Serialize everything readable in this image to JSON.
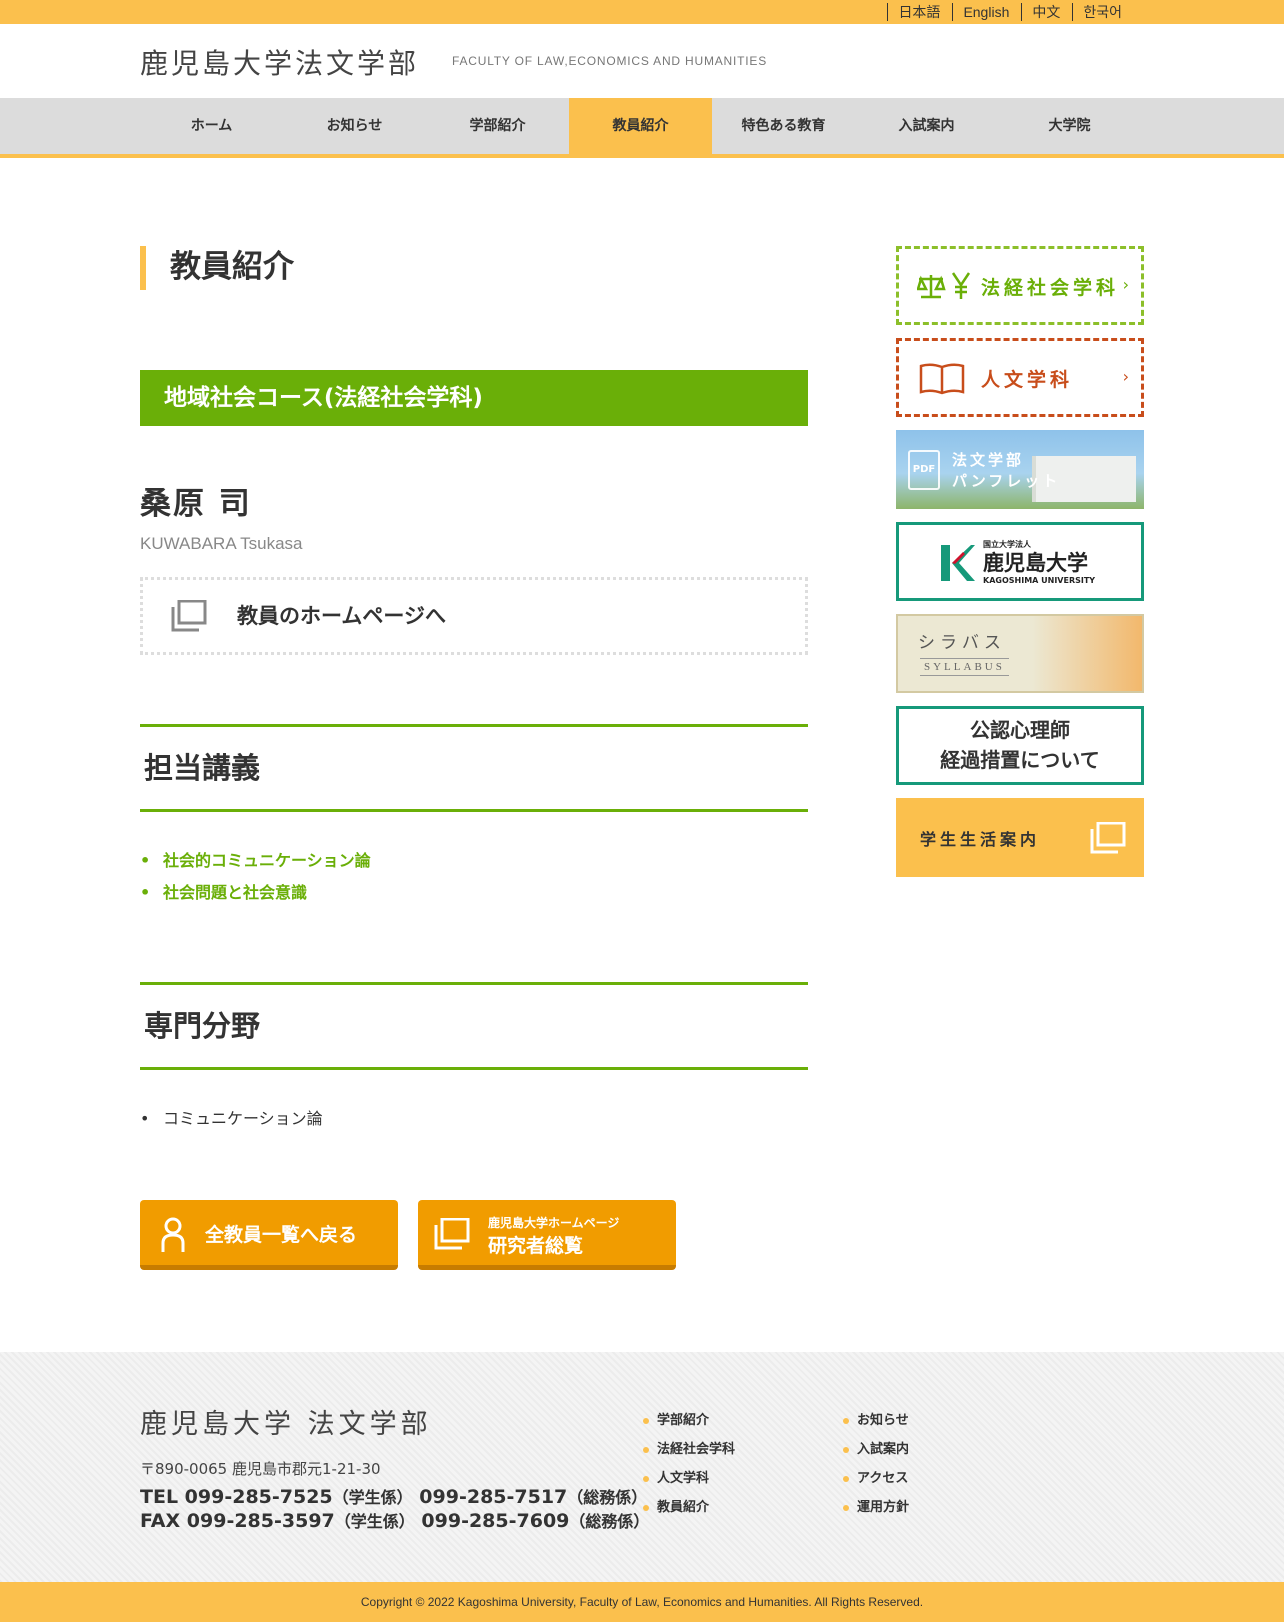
{
  "top_langs": [
    "日本語",
    "English",
    "中文",
    "한국어"
  ],
  "header": {
    "title": "鹿児島大学法文学部",
    "subtitle": "FACULTY OF LAW,ECONOMICS AND HUMANITIES"
  },
  "nav": {
    "items": [
      "ホーム",
      "お知らせ",
      "学部紹介",
      "教員紹介",
      "特色ある教育",
      "入試案内",
      "大学院"
    ],
    "active": "教員紹介"
  },
  "page": {
    "title": "教員紹介",
    "course": "地域社会コース(法経社会学科)",
    "name_jp": "桑原 司",
    "name_en": "KUWABARA Tsukasa",
    "homepage_label": "教員のホームページへ"
  },
  "courses_section": {
    "heading": "担当講義",
    "items": [
      "社会的コミュニケーション論",
      "社会問題と社会意識"
    ]
  },
  "field_section": {
    "heading": "専門分野",
    "items": [
      "コミュニケーション論"
    ]
  },
  "buttons": {
    "back_label": "全教員一覧へ戻る",
    "research_small": "鹿児島大学ホームページ",
    "research_big": "研究者総覧"
  },
  "sidebar": {
    "law_label": "法経社会学科",
    "humanities_label": "人文学科",
    "pamphlet_line1": "法文学部",
    "pamphlet_line2": "パンフレット",
    "pdf_icon": "PDF",
    "ku_small": "国立大学法人",
    "ku_name": "鹿児島大学",
    "ku_en": "KAGOSHIMA UNIVERSITY",
    "syllabus_jp": "シラバス",
    "syllabus_en": "SYLLABUS",
    "cpp_line1": "公認心理師",
    "cpp_line2": "経過措置について",
    "student_label": "学生生活案内"
  },
  "footer": {
    "title": "鹿児島大学 法文学部",
    "address": "〒890-0065 鹿児島市郡元1-21-30",
    "tel_label": "TEL",
    "tel1": "099-285-7525",
    "tel1_note": "（学生係）",
    "tel2": "099-285-7517",
    "tel2_note": "（総務係）",
    "fax_label": "FAX",
    "fax1": "099-285-3597",
    "fax1_note": "（学生係）",
    "fax2": "099-285-7609",
    "fax2_note": "（総務係）",
    "links_col1": [
      "学部紹介",
      "法経社会学科",
      "人文学科",
      "教員紹介"
    ],
    "links_col2": [
      "お知らせ",
      "入試案内",
      "アクセス",
      "運用方針"
    ]
  },
  "copyright": "Copyright © 2022 Kagoshima University, Faculty of Law, Economics and Humanities. All Rights Reserved.",
  "colors": {
    "accent": "#fbc04d",
    "green": "#6aaf08",
    "orange": "#f19c00",
    "teal": "#16997a",
    "rust": "#c84d1b"
  }
}
